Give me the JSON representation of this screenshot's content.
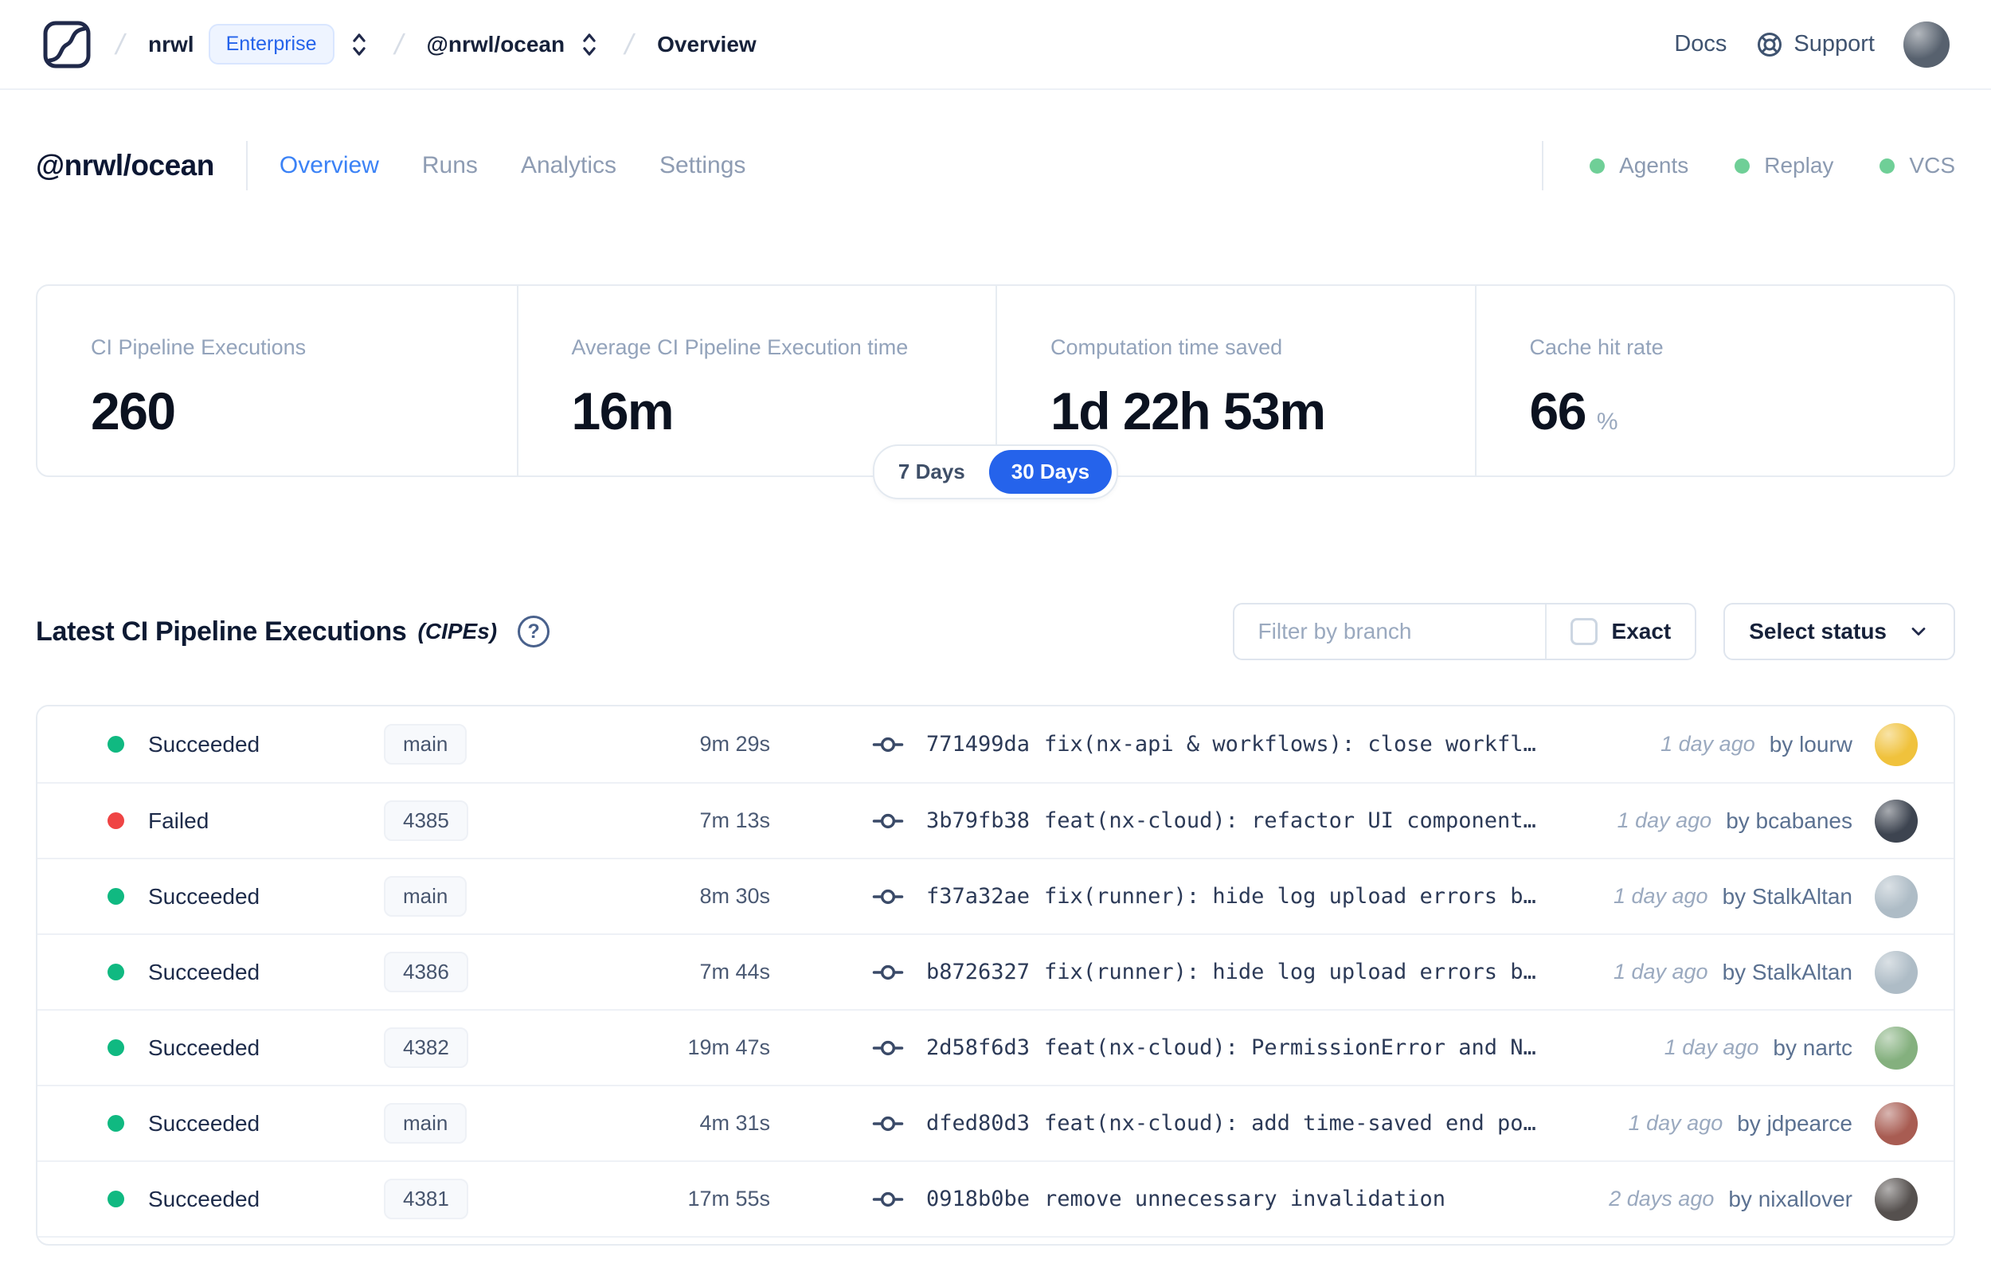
{
  "nav": {
    "separator": "/",
    "org": "nrwl",
    "org_badge": "Enterprise",
    "workspace": "@nrwl/ocean",
    "page": "Overview",
    "docs_label": "Docs",
    "support_label": "Support"
  },
  "header": {
    "title": "@nrwl/ocean",
    "tabs": [
      {
        "label": "Overview",
        "active": true
      },
      {
        "label": "Runs",
        "active": false
      },
      {
        "label": "Analytics",
        "active": false
      },
      {
        "label": "Settings",
        "active": false
      }
    ],
    "integrations": [
      {
        "label": "Agents"
      },
      {
        "label": "Replay"
      },
      {
        "label": "VCS"
      }
    ]
  },
  "stats": {
    "period_options": [
      "7 Days",
      "30 Days"
    ],
    "selected_period": "30 Days",
    "cards": [
      {
        "label": "CI Pipeline Executions",
        "value": "260",
        "unit": ""
      },
      {
        "label": "Average CI Pipeline Execution time",
        "value": "16m",
        "unit": ""
      },
      {
        "label": "Computation time saved",
        "value": "1d 22h 53m",
        "unit": ""
      },
      {
        "label": "Cache hit rate",
        "value": "66",
        "unit": "%"
      }
    ]
  },
  "cipes": {
    "title": "Latest CI Pipeline Executions",
    "title_suffix": "(CIPEs)",
    "filter_placeholder": "Filter by branch",
    "exact_label": "Exact",
    "status_dropdown_label": "Select status",
    "rows": [
      {
        "status": "Succeeded",
        "branch": "main",
        "duration": "9m 29s",
        "hash": "771499da",
        "message": "fix(nx-api & workflows): close workfl…",
        "time": "1 day ago",
        "author": "by lourw",
        "avatar_color": "#f0c23c"
      },
      {
        "status": "Failed",
        "branch": "4385",
        "duration": "7m 13s",
        "hash": "3b79fb38",
        "message": "feat(nx-cloud): refactor UI component…",
        "time": "1 day ago",
        "author": "by bcabanes",
        "avatar_color": "#3d4450"
      },
      {
        "status": "Succeeded",
        "branch": "main",
        "duration": "8m 30s",
        "hash": "f37a32ae",
        "message": "fix(runner): hide log upload errors b…",
        "time": "1 day ago",
        "author": "by StalkAltan",
        "avatar_color": "#aebcc6"
      },
      {
        "status": "Succeeded",
        "branch": "4386",
        "duration": "7m 44s",
        "hash": "b8726327",
        "message": "fix(runner): hide log upload errors b…",
        "time": "1 day ago",
        "author": "by StalkAltan",
        "avatar_color": "#aebcc6"
      },
      {
        "status": "Succeeded",
        "branch": "4382",
        "duration": "19m 47s",
        "hash": "2d58f6d3",
        "message": "feat(nx-cloud): PermissionError and N…",
        "time": "1 day ago",
        "author": "by nartc",
        "avatar_color": "#84b07e"
      },
      {
        "status": "Succeeded",
        "branch": "main",
        "duration": "4m 31s",
        "hash": "dfed80d3",
        "message": "feat(nx-cloud): add time-saved end po…",
        "time": "1 day ago",
        "author": "by jdpearce",
        "avatar_color": "#a85c52"
      },
      {
        "status": "Succeeded",
        "branch": "4381",
        "duration": "17m 55s",
        "hash": "0918b0be",
        "message": "remove unnecessary invalidation",
        "time": "2 days ago",
        "author": "by nixallover",
        "avatar_color": "#55504e"
      }
    ]
  },
  "colors": {
    "accent": "#2563eb",
    "succeeded": "#10b981",
    "failed": "#ef4444",
    "integration_dot": "#6fcf97",
    "nav_avatar": "#57616e"
  }
}
